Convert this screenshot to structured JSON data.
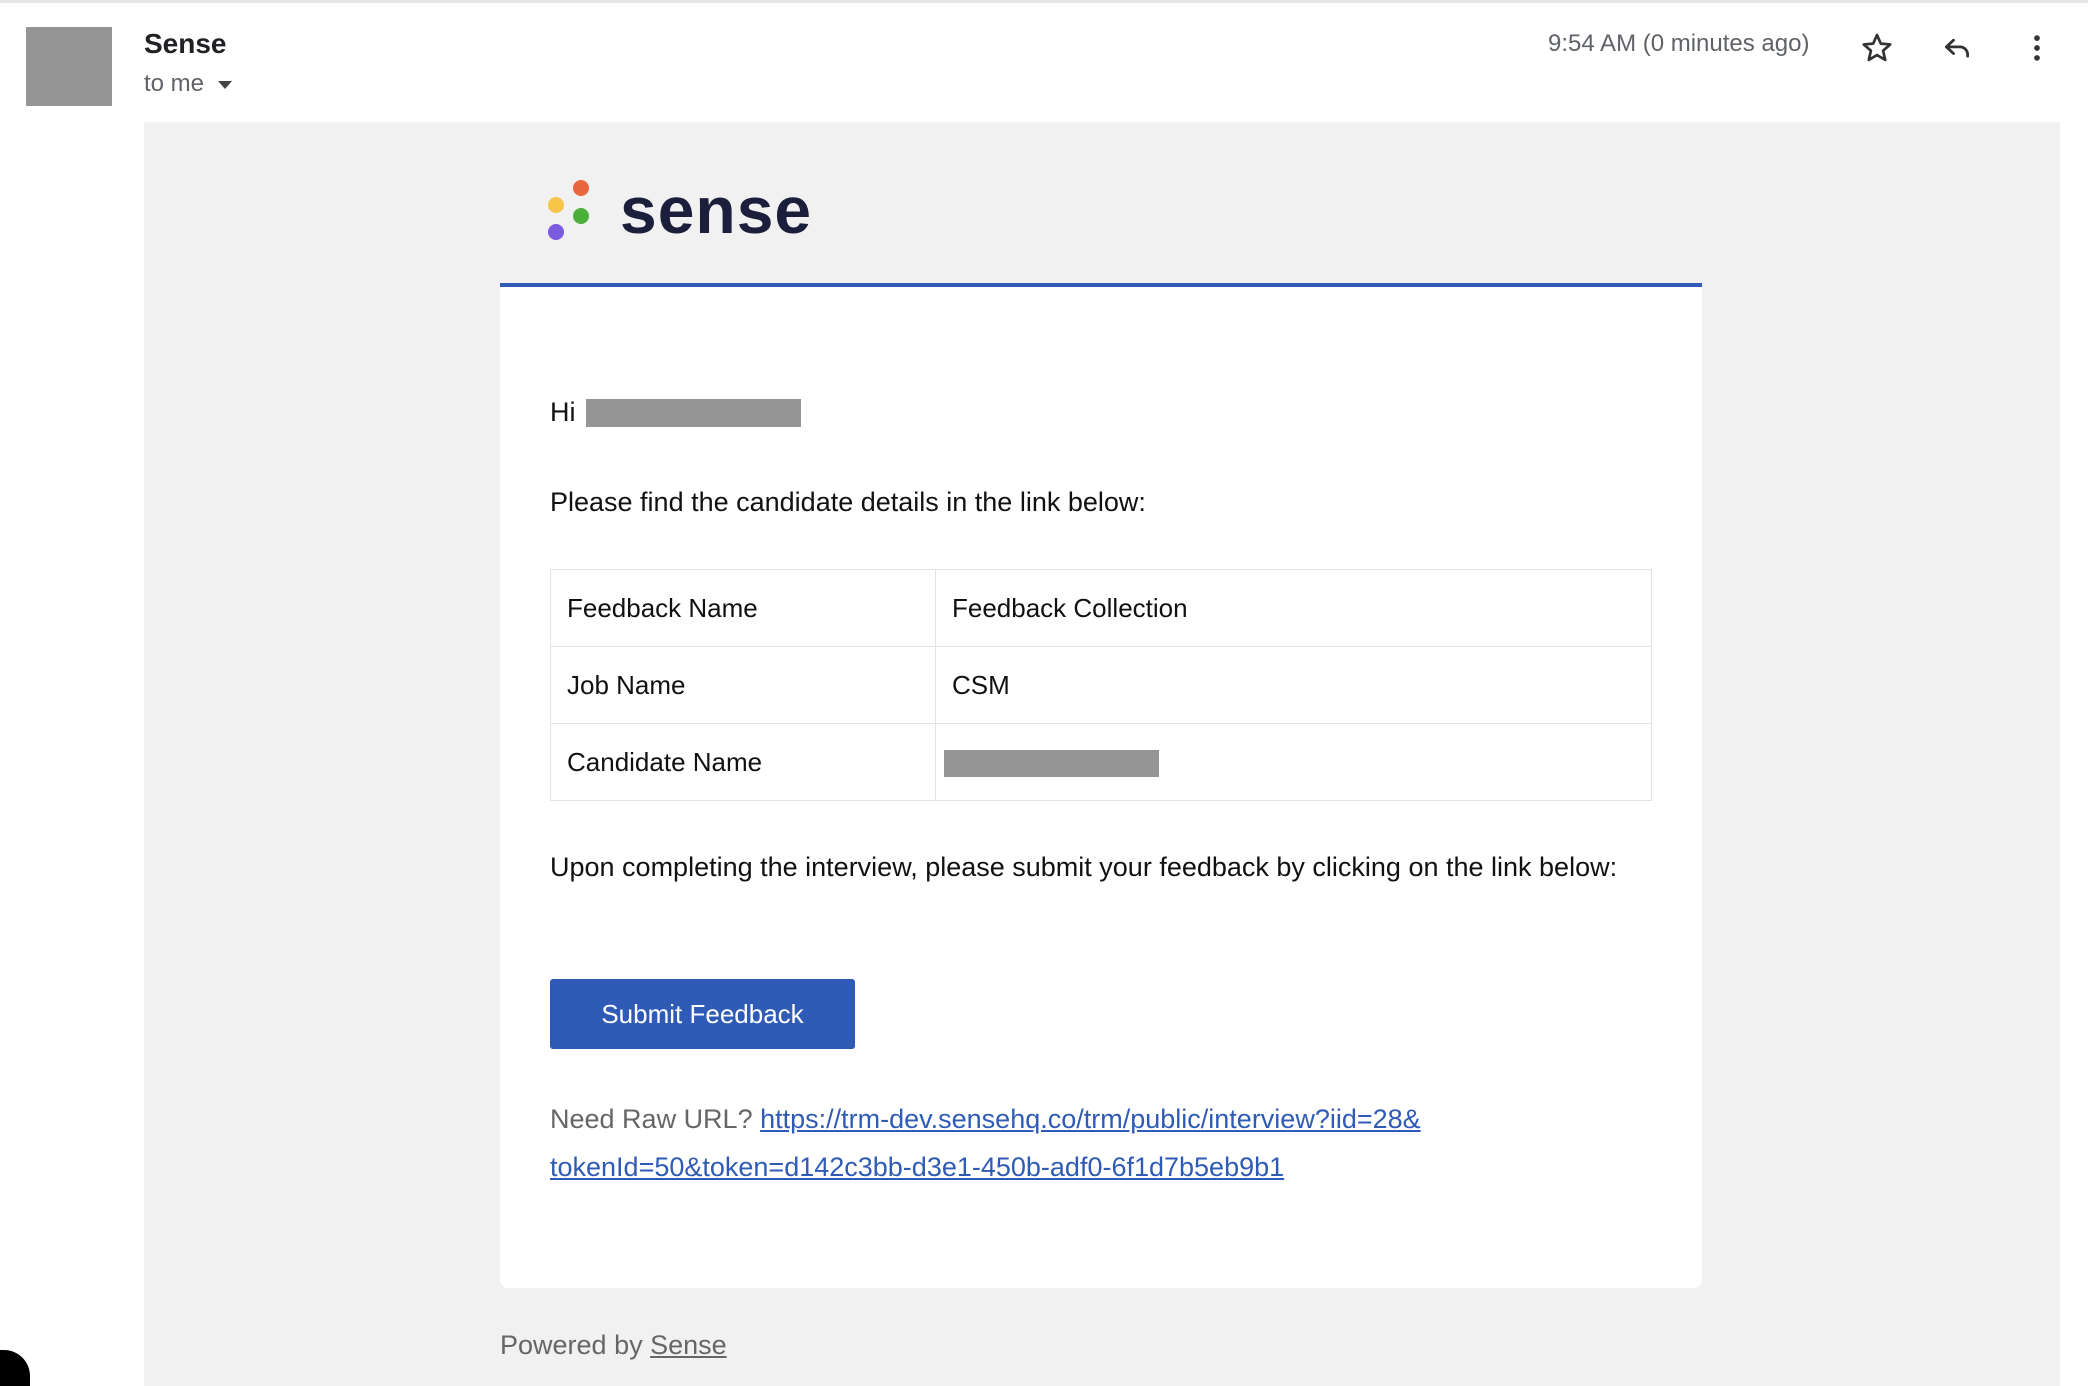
{
  "header": {
    "sender": "Sense",
    "recipient_label": "to me",
    "time": "9:54 AM (0 minutes ago)",
    "icons": [
      "star-icon",
      "reply-icon",
      "more-vert-icon"
    ]
  },
  "logo": {
    "word": "sense",
    "dot_colors": [
      "#e8663d",
      "#f7c548",
      "#4caf3a",
      "#7b5ce0"
    ]
  },
  "email": {
    "greeting": "Hi",
    "intro": "Please find the candidate details in the link below:",
    "details": [
      {
        "label": "Feedback Name",
        "value": "Feedback Collection"
      },
      {
        "label": "Job Name",
        "value": "CSM"
      },
      {
        "label": "Candidate Name",
        "value": ""
      }
    ],
    "instruction": "Upon completing the interview, please submit your feedback by clicking on the link below:",
    "submit_label": "Submit Feedback",
    "raw_url_prompt": "Need Raw URL?",
    "raw_url": "https://trm-dev.sensehq.co/trm/public/interview?iid=28&tokenId=50&token=d142c3bb-d3e1-450b-adf0-6f1d7b5eb9b1"
  },
  "footer": {
    "powered_prefix": "Powered by",
    "powered_link": "Sense"
  },
  "colors": {
    "accent": "#2f5bb7",
    "email_background": "#f1f1f1",
    "redaction": "#959595"
  }
}
